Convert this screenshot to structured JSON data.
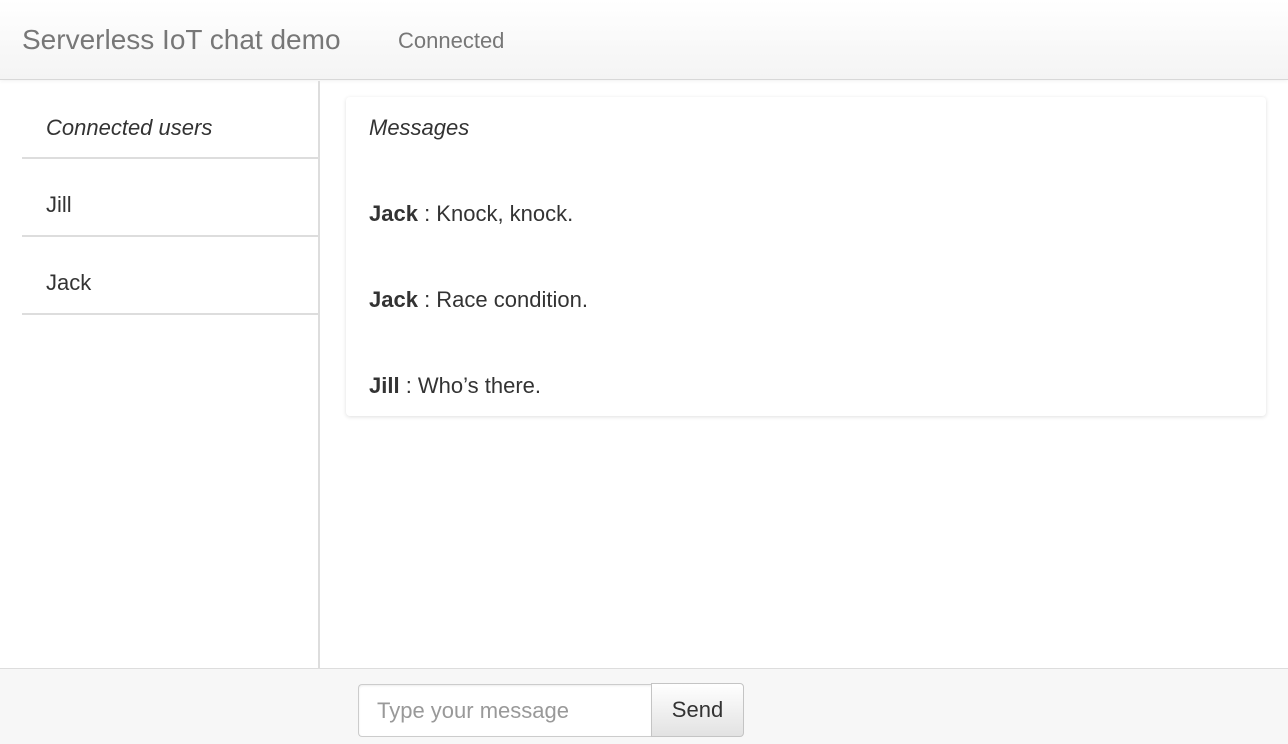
{
  "navbar": {
    "brand": "Serverless IoT chat demo",
    "status": "Connected"
  },
  "sidebar": {
    "header": "Connected users",
    "users": [
      "Jill",
      "Jack"
    ]
  },
  "messages_panel": {
    "title": "Messages",
    "messages": [
      {
        "author": "Jack",
        "separator": " : ",
        "text": "Knock, knock."
      },
      {
        "author": "Jack",
        "separator": " : ",
        "text": "Race condition."
      },
      {
        "author": "Jill",
        "separator": " : ",
        "text": "Who’s there."
      }
    ]
  },
  "composer": {
    "placeholder": "Type your message",
    "value": "",
    "send_label": "Send"
  }
}
